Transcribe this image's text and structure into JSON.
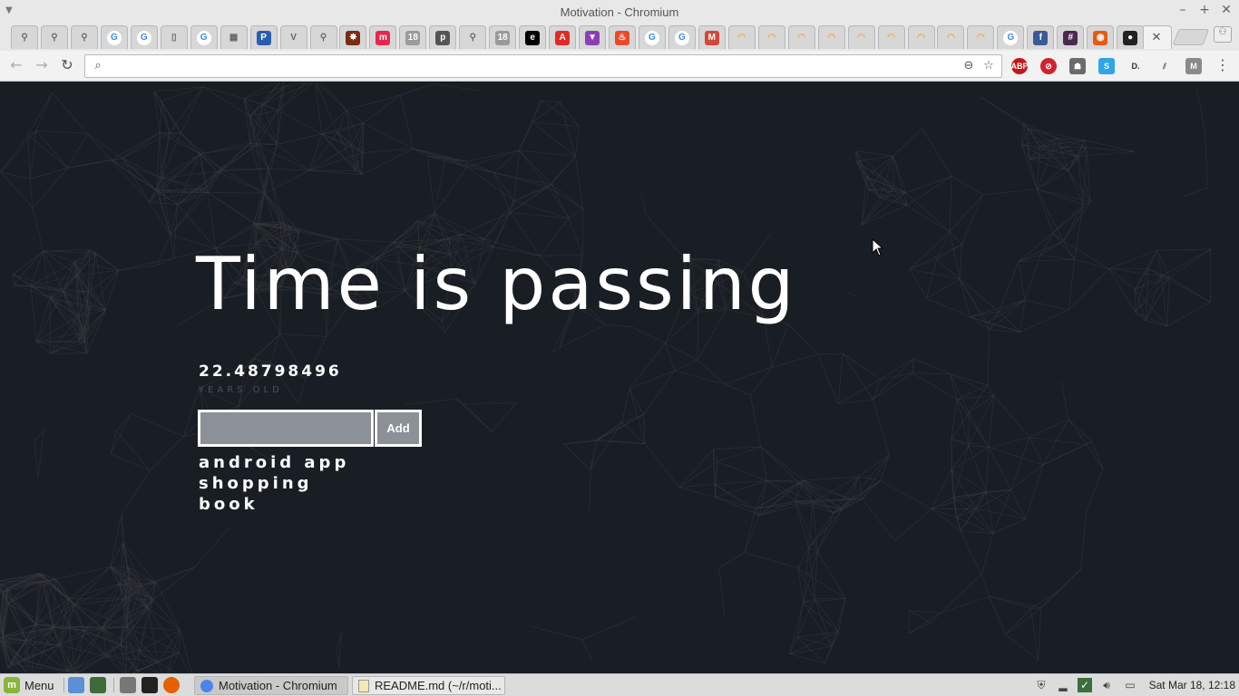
{
  "window": {
    "title": "Motivation - Chromium",
    "controls": {
      "minimize": "–",
      "maximize": "+",
      "close": "✕"
    }
  },
  "tabs": [
    {
      "icon": "location-pin-icon",
      "color": "#e4e4e4",
      "glyph": "⚲"
    },
    {
      "icon": "location-pin-icon",
      "color": "#e4e4e4",
      "glyph": "⚲"
    },
    {
      "icon": "location-pin-icon",
      "color": "#e4e4e4",
      "glyph": "⚲"
    },
    {
      "icon": "google-icon",
      "color": "#4285f4",
      "glyph": "G"
    },
    {
      "icon": "google-icon",
      "color": "#4285f4",
      "glyph": "G"
    },
    {
      "icon": "document-icon",
      "color": "#e4e4e4",
      "glyph": "▯"
    },
    {
      "icon": "google-icon",
      "color": "#4285f4",
      "glyph": "G"
    },
    {
      "icon": "spreadsheet-icon",
      "color": "#e4e4e4",
      "glyph": "▦"
    },
    {
      "icon": "p-icon",
      "color": "#2a5fb0",
      "glyph": "P"
    },
    {
      "icon": "v-leaf-icon",
      "color": "#e4e4e4",
      "glyph": "V"
    },
    {
      "icon": "location-pin-icon",
      "color": "#e4e4e4",
      "glyph": "⚲"
    },
    {
      "icon": "bug-icon",
      "color": "#7a2b10",
      "glyph": "✸"
    },
    {
      "icon": "m-script-icon",
      "color": "#e8264c",
      "glyph": "m"
    },
    {
      "icon": "calendar-icon",
      "color": "#9a9a9a",
      "glyph": "18"
    },
    {
      "icon": "p-circle-icon",
      "color": "#555555",
      "glyph": "p"
    },
    {
      "icon": "location-pin-icon",
      "color": "#e4e4e4",
      "glyph": "⚲"
    },
    {
      "icon": "calendar-icon",
      "color": "#9a9a9a",
      "glyph": "18"
    },
    {
      "icon": "e-icon",
      "color": "#000000",
      "glyph": "e"
    },
    {
      "icon": "adobe-icon",
      "color": "#e02a26",
      "glyph": "A"
    },
    {
      "icon": "v-triangle-icon",
      "color": "#8c3fb5",
      "glyph": "▼"
    },
    {
      "icon": "flame-icon",
      "color": "#ea4a28",
      "glyph": "♨"
    },
    {
      "icon": "google-icon",
      "color": "#4285f4",
      "glyph": "G"
    },
    {
      "icon": "google-icon",
      "color": "#4285f4",
      "glyph": "G"
    },
    {
      "icon": "gmail-icon",
      "color": "#d44638",
      "glyph": "M"
    },
    {
      "icon": "rainbow-icon",
      "color": "#f2a93b",
      "glyph": "◠"
    },
    {
      "icon": "rainbow-icon",
      "color": "#f2a93b",
      "glyph": "◠"
    },
    {
      "icon": "rainbow-icon",
      "color": "#f2a93b",
      "glyph": "◠"
    },
    {
      "icon": "rainbow-icon",
      "color": "#f2a93b",
      "glyph": "◠"
    },
    {
      "icon": "rainbow-icon",
      "color": "#f2a93b",
      "glyph": "◠"
    },
    {
      "icon": "rainbow-icon",
      "color": "#f2a93b",
      "glyph": "◠"
    },
    {
      "icon": "rainbow-icon",
      "color": "#f2a93b",
      "glyph": "◠"
    },
    {
      "icon": "rainbow-icon",
      "color": "#f2a93b",
      "glyph": "◠"
    },
    {
      "icon": "rainbow-icon",
      "color": "#f2a93b",
      "glyph": "◠"
    },
    {
      "icon": "google-icon",
      "color": "#4285f4",
      "glyph": "G"
    },
    {
      "icon": "facebook-icon",
      "color": "#3b5998",
      "glyph": "f"
    },
    {
      "icon": "slack-hash-icon",
      "color": "#4a2a4e",
      "glyph": "#"
    },
    {
      "icon": "orange-circle-icon",
      "color": "#e55b13",
      "glyph": "◉"
    },
    {
      "icon": "github-icon",
      "color": "#222222",
      "glyph": "●"
    }
  ],
  "active_tab": {
    "icon": "close-icon",
    "glyph": "✕"
  },
  "toolbar": {
    "back_glyph": "←",
    "forward_glyph": "→",
    "reload_glyph": "↻",
    "omnibox_value": "",
    "search_glyph": "⌕",
    "zoom_glyph": "⊖",
    "star_glyph": "☆",
    "menu_glyph": "⋮"
  },
  "extensions": [
    {
      "icon": "adblock-plus-icon",
      "color": "#c4161c",
      "glyph": "ABP"
    },
    {
      "icon": "block-icon",
      "color": "#d4212f",
      "glyph": "⊘"
    },
    {
      "icon": "ghost-icon",
      "color": "#6b6b6b",
      "glyph": "☗"
    },
    {
      "icon": "s-icon",
      "color": "#2fa4e7",
      "glyph": "S"
    },
    {
      "icon": "d-icon",
      "color": "#333333",
      "glyph": "D."
    },
    {
      "icon": "books-icon",
      "color": "#666666",
      "glyph": "⫽"
    },
    {
      "icon": "m-gray-icon",
      "color": "#8a8a8a",
      "glyph": "M"
    }
  ],
  "page": {
    "headline": "Time is passing",
    "age_value": "22.48798496",
    "age_unit": "YEARS OLD",
    "task_input_value": "",
    "add_label": "Add",
    "tasks": [
      "android app",
      "shopping",
      "book"
    ],
    "colors": {
      "background": "#191e25",
      "text": "#ffffff",
      "muted": "#4c5058",
      "input_bg": "#8c9097"
    }
  },
  "taskbar": {
    "menu_label": "Menu",
    "windows": [
      {
        "label": "Motivation - Chromium",
        "icon": "chromium-icon",
        "active": true
      },
      {
        "label": "README.md (~/r/moti...",
        "icon": "text-editor-icon",
        "active": false
      }
    ],
    "clock": "Sat Mar 18, 12:18"
  }
}
